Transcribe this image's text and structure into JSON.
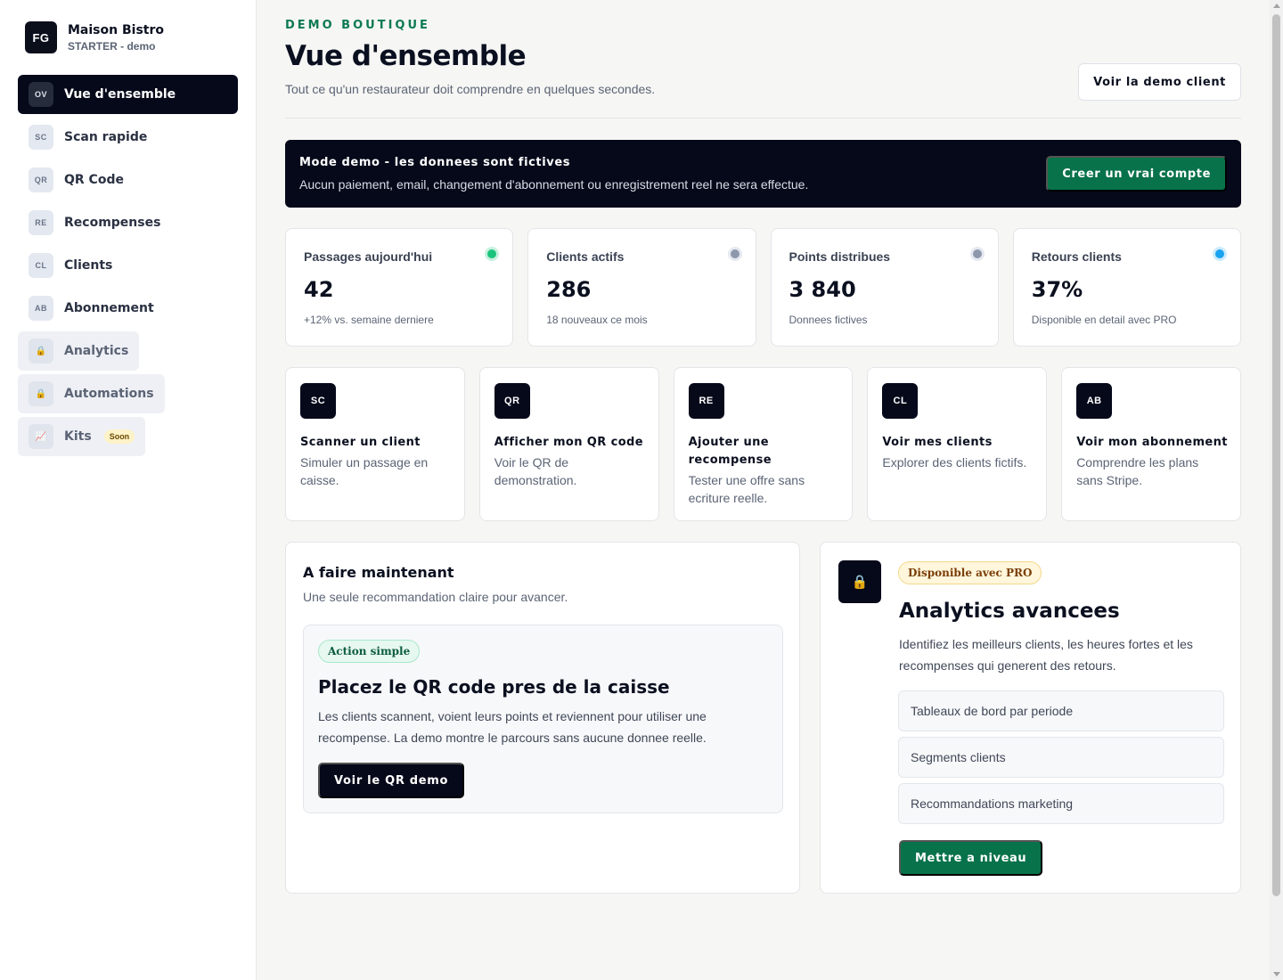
{
  "brand": {
    "initials": "FG",
    "name": "Maison Bistro",
    "plan": "STARTER - demo"
  },
  "sidebar": {
    "items": [
      {
        "abbr": "OV",
        "label": "Vue d'ensemble",
        "active": true
      },
      {
        "abbr": "SC",
        "label": "Scan rapide"
      },
      {
        "abbr": "QR",
        "label": "QR Code"
      },
      {
        "abbr": "RE",
        "label": "Recompenses"
      },
      {
        "abbr": "CL",
        "label": "Clients"
      },
      {
        "abbr": "AB",
        "label": "Abonnement"
      },
      {
        "abbr": "🔒",
        "label": "Analytics",
        "locked": true,
        "icon": "lock-icon"
      },
      {
        "abbr": "🔒",
        "label": "Automations",
        "locked": true,
        "icon": "lock-icon"
      },
      {
        "abbr": "📈",
        "label": "Kits",
        "locked": true,
        "badge": "Soon",
        "icon": "chart-icon"
      }
    ]
  },
  "header": {
    "eyebrow": "DEMO BOUTIQUE",
    "title": "Vue d'ensemble",
    "subtitle": "Tout ce qu'un restaurateur doit comprendre en quelques secondes.",
    "demo_client_button": "Voir la demo client"
  },
  "banner": {
    "title": "Mode demo - les donnees sont fictives",
    "description": "Aucun paiement, email, changement d'abonnement ou enregistrement reel ne sera effectue.",
    "cta": "Creer un vrai compte"
  },
  "stats": [
    {
      "label": "Passages aujourd'hui",
      "value": "42",
      "note": "+12% vs. semaine derniere",
      "dot_color": "#1bc47d",
      "dot_ring": "#c8f1de"
    },
    {
      "label": "Clients actifs",
      "value": "286",
      "note": "18 nouveaux ce mois",
      "dot_color": "#8e98ad",
      "dot_ring": "#e6e9f0"
    },
    {
      "label": "Points distribues",
      "value": "3 840",
      "note": "Donnees fictives",
      "dot_color": "#8e98ad",
      "dot_ring": "#e6e9f0"
    },
    {
      "label": "Retours clients",
      "value": "37%",
      "note": "Disponible en detail avec PRO",
      "dot_color": "#1aa3f0",
      "dot_ring": "#cdebfc"
    }
  ],
  "quick_actions": [
    {
      "abbr": "SC",
      "title": "Scanner un client",
      "description": "Simuler un passage en caisse."
    },
    {
      "abbr": "QR",
      "title": "Afficher mon QR code",
      "description": "Voir le QR de demonstration."
    },
    {
      "abbr": "RE",
      "title": "Ajouter une recompense",
      "description": "Tester une offre sans ecriture reelle."
    },
    {
      "abbr": "CL",
      "title": "Voir mes clients",
      "description": "Explorer des clients fictifs."
    },
    {
      "abbr": "AB",
      "title": "Voir mon abonnement",
      "description": "Comprendre les plans sans Stripe."
    }
  ],
  "todo": {
    "title": "A faire maintenant",
    "subtitle": "Une seule recommandation claire pour avancer.",
    "badge": "Action simple",
    "card_title": "Placez le QR code pres de la caisse",
    "card_description": "Les clients scannent, voient leurs points et reviennent pour utiliser une recompense. La demo montre le parcours sans aucune donnee reelle.",
    "cta": "Voir le QR demo"
  },
  "pro": {
    "icon": "lock-icon",
    "badge": "Disponible avec PRO",
    "title": "Analytics avancees",
    "description": "Identifiez les meilleurs clients, les heures fortes et les recompenses qui generent des retours.",
    "features": [
      "Tableaux de bord par periode",
      "Segments clients",
      "Recommandations marketing"
    ],
    "cta": "Mettre a niveau"
  },
  "colors": {
    "accent_green": "#08724a",
    "dark": "#05091a",
    "eyebrow": "#0f7a52"
  }
}
